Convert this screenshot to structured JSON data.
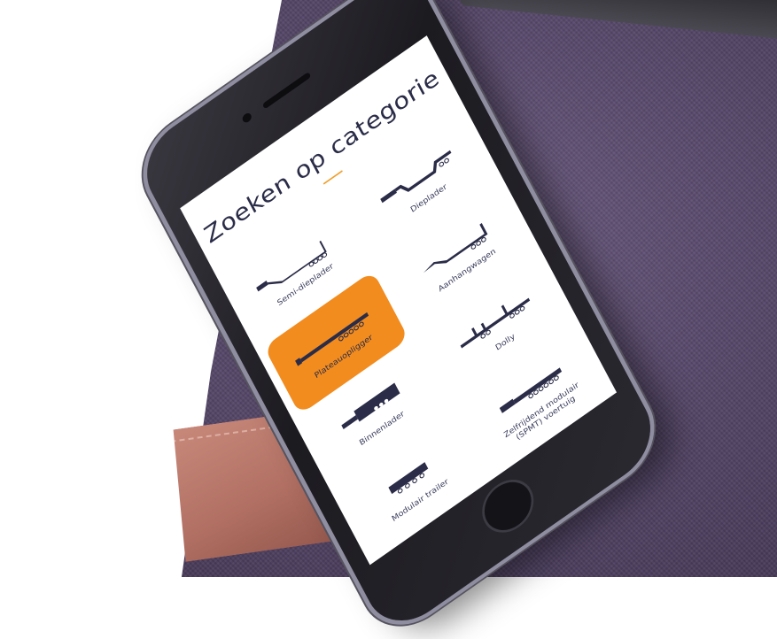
{
  "screen": {
    "title": "Zoeken op categorie"
  },
  "categories": [
    {
      "label": "Dieplader",
      "icon": "dieplader-icon",
      "active": false
    },
    {
      "label": "Semi-dieplader",
      "icon": "semi-dieplader-icon",
      "active": false
    },
    {
      "label": "Aanhangwagen",
      "icon": "aanhangwagen-icon",
      "active": false
    },
    {
      "label": "Plateauopligger",
      "icon": "plateauopligger-icon",
      "active": true
    },
    {
      "label": "Dolly",
      "icon": "dolly-icon",
      "active": false
    },
    {
      "label": "Binnenlader",
      "icon": "binnenlader-icon",
      "active": false
    },
    {
      "label": "Zelfrijdend modulair (SPMT) voertuig",
      "icon": "spmt-icon",
      "active": false
    },
    {
      "label": "Modulair trailer",
      "icon": "modulair-trailer-icon",
      "active": false
    }
  ],
  "colors": {
    "accent": "#f28c1e",
    "text": "#2a2c48",
    "fabric": "#564769"
  }
}
